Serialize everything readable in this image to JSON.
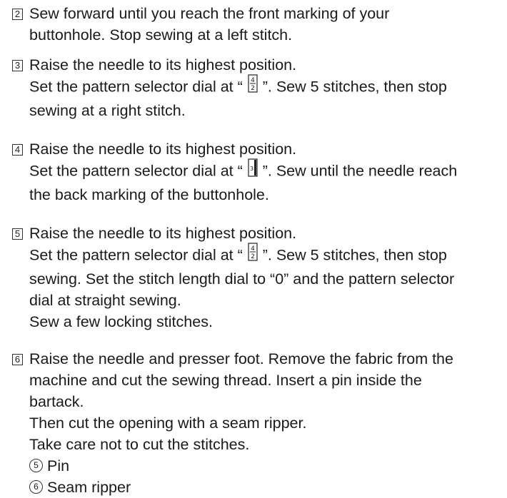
{
  "steps": [
    {
      "number": "2",
      "lines": [
        "Sew forward until you reach the front marking of your",
        "buttonhole. Stop sewing at a left stitch."
      ]
    },
    {
      "number": "3",
      "lines": [
        "Raise the needle to its highest position.",
        "Set the pattern selector dial at “",
        "”. Sew 5 stitches, then stop",
        "sewing at a right stitch."
      ]
    },
    {
      "number": "4",
      "lines": [
        "Raise the needle to its highest position.",
        "Set the pattern selector dial at “",
        "”. Sew until the needle reach",
        "the back marking of the buttonhole."
      ]
    },
    {
      "number": "5",
      "lines": [
        "Raise the needle to its highest position.",
        "Set the pattern selector dial at “",
        "”. Sew 5 stitches, then stop",
        "sewing. Set the stitch length dial to “0” and the pattern selector",
        "dial at straight sewing.",
        "Sew a few locking stitches."
      ]
    },
    {
      "number": "6",
      "lines": [
        "Raise the needle and presser foot. Remove the fabric from the",
        "machine and cut the sewing thread. Insert a pin inside the",
        "bartack.",
        "Then cut the opening with a seam ripper.",
        "Take care not to cut the stitches."
      ],
      "items": [
        {
          "marker": "5",
          "label": "Pin"
        },
        {
          "marker": "6",
          "label": "Seam ripper"
        }
      ]
    }
  ],
  "icons": {
    "bartack_icon": "bartack-pattern-icon",
    "buttonhole_side_icon": "buttonhole-side-pattern-icon"
  }
}
